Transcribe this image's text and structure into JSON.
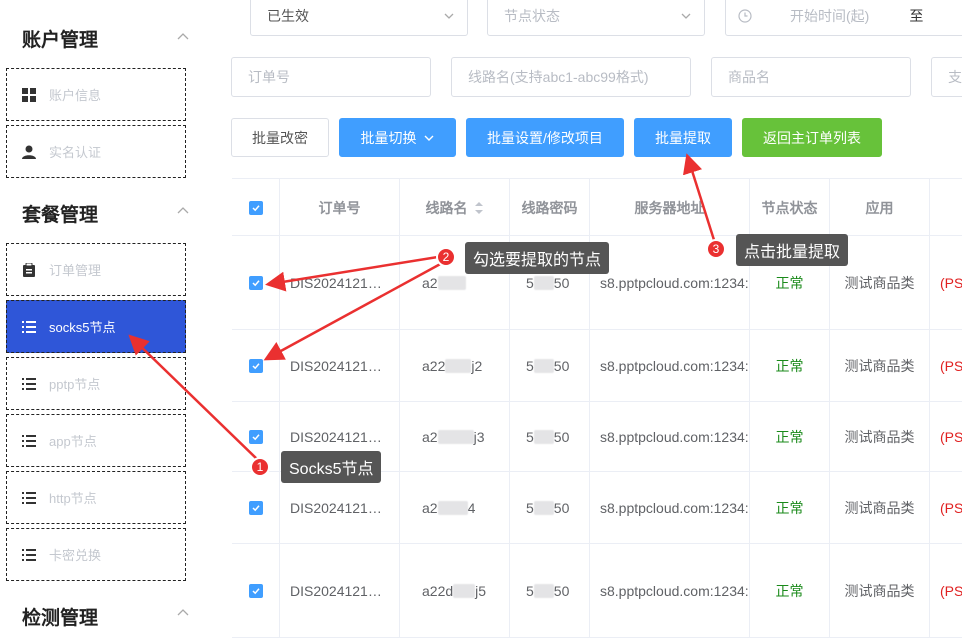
{
  "sidebar": {
    "groups": [
      {
        "title": "账户管理"
      },
      {
        "title": "套餐管理"
      },
      {
        "title": "检测管理"
      }
    ],
    "items": [
      {
        "label": "账户信息"
      },
      {
        "label": "实名认证"
      },
      {
        "label": "订单管理"
      },
      {
        "label": "socks5节点"
      },
      {
        "label": "pptp节点"
      },
      {
        "label": "app节点"
      },
      {
        "label": "http节点"
      },
      {
        "label": "卡密兑换"
      }
    ]
  },
  "filters": {
    "status_value": "已生效",
    "node_status_placeholder": "节点状态",
    "start_time_placeholder": "开始时间(起)",
    "range_sep": "至",
    "order_no_placeholder": "订单号",
    "line_name_placeholder": "线路名(支持abc1-abc99格式)",
    "product_placeholder": "商品名",
    "extra_placeholder": "支"
  },
  "toolbar": {
    "change_pwd": "批量改密",
    "switch": "批量切换",
    "settings": "批量设置/修改项目",
    "extract": "批量提取",
    "back": "返回主订单列表"
  },
  "table": {
    "headers": [
      "订单号",
      "线路名",
      "线路密码",
      "服务器地址",
      "节点状态",
      "应用"
    ],
    "rows": [
      {
        "order": "DIS2024121…",
        "line_a": "a2",
        "line_b": "",
        "pwd_a": "5",
        "pwd_b": "50",
        "server": "s8.pptpcloud.com:1234:",
        "status": "正常",
        "app": "测试商品类",
        "ps": "(PS"
      },
      {
        "order": "DIS2024121…",
        "line_a": "a22",
        "line_b": "j2",
        "pwd_a": "5",
        "pwd_b": "50",
        "server": "s8.pptpcloud.com:1234:",
        "status": "正常",
        "app": "测试商品类",
        "ps": "(PS"
      },
      {
        "order": "DIS2024121…",
        "line_a": "a2",
        "line_b": "j3",
        "pwd_a": "5",
        "pwd_b": "50",
        "server": "s8.pptpcloud.com:1234:",
        "status": "正常",
        "app": "测试商品类",
        "ps": "(PS"
      },
      {
        "order": "DIS2024121…",
        "line_a": "a2",
        "line_b": "4",
        "pwd_a": "5",
        "pwd_b": "50",
        "server": "s8.pptpcloud.com:1234:",
        "status": "正常",
        "app": "测试商品类",
        "ps": "(PS"
      },
      {
        "order": "DIS2024121…",
        "line_a": "a22d",
        "line_b": "j5",
        "pwd_a": "5",
        "pwd_b": "50",
        "server": "s8.pptpcloud.com:1234:",
        "status": "正常",
        "app": "测试商品类",
        "ps": "(PS"
      }
    ]
  },
  "annotations": [
    {
      "num": "1",
      "text": "Socks5节点"
    },
    {
      "num": "2",
      "text": "勾选要提取的节点"
    },
    {
      "num": "3",
      "text": "点击批量提取"
    }
  ],
  "colors": {
    "accent": "#409eff",
    "active_nav": "#2f56d8",
    "success": "#67c23a",
    "annotation_red": "#ea3030"
  }
}
